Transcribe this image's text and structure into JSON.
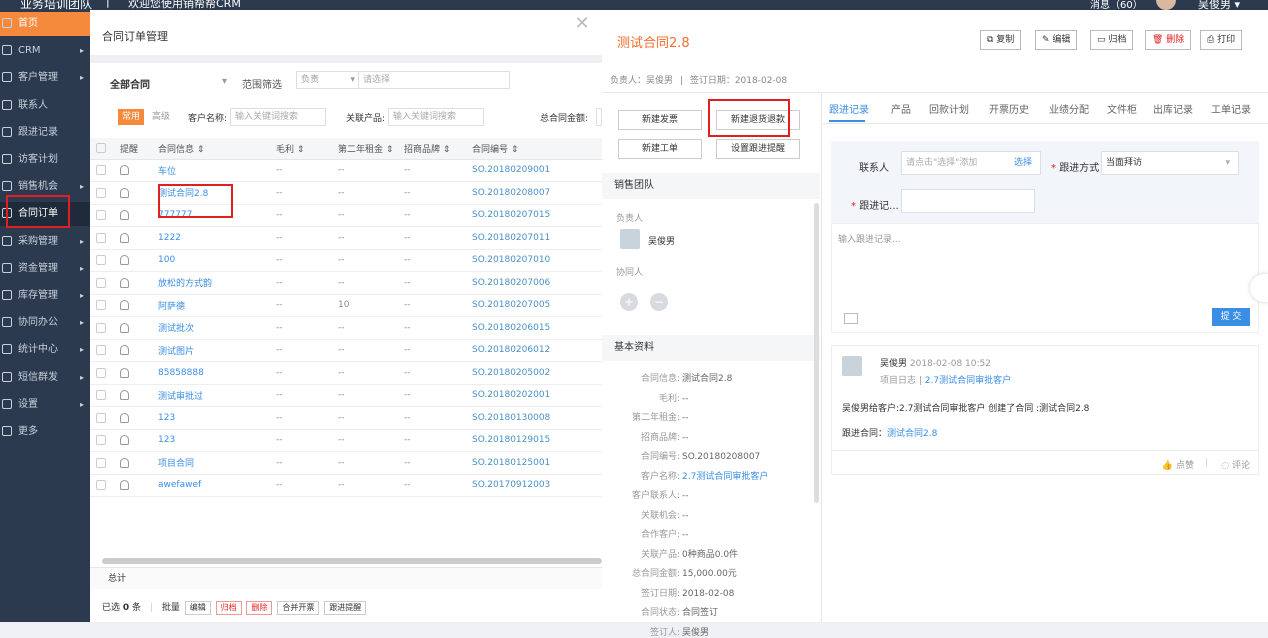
{
  "topbar": {
    "company": "业务培训团队",
    "separator": "|",
    "welcome": "欢迎您使用销帮帮CRM",
    "messages": "消息（60）",
    "user": "吴俊男 ▾"
  },
  "sidebar": {
    "items": [
      {
        "label": "首页",
        "arrow": ""
      },
      {
        "label": "CRM",
        "arrow": "▸"
      },
      {
        "label": "客户管理",
        "arrow": "▸"
      },
      {
        "label": "联系人",
        "arrow": ""
      },
      {
        "label": "跟进记录",
        "arrow": ""
      },
      {
        "label": "访客计划",
        "arrow": ""
      },
      {
        "label": "销售机会",
        "arrow": "▸"
      },
      {
        "label": "合同订单",
        "arrow": ""
      },
      {
        "label": "采购管理",
        "arrow": "▸"
      },
      {
        "label": "资金管理",
        "arrow": "▸"
      },
      {
        "label": "库存管理",
        "arrow": "▸"
      },
      {
        "label": "协同办公",
        "arrow": "▸"
      },
      {
        "label": "统计中心",
        "arrow": "▸"
      },
      {
        "label": "短信群发",
        "arrow": "▸"
      },
      {
        "label": "设置",
        "arrow": "▸"
      },
      {
        "label": "更多",
        "arrow": ""
      }
    ]
  },
  "list": {
    "page_title": "合同订单管理",
    "all_label": "全部合同",
    "range_label": "范围筛选",
    "range_value": "负责",
    "range_placeholder": "请选择",
    "tab_common": "常用",
    "tab_advanced": "高级",
    "customer_label": "客户名称:",
    "customer_placeholder": "输入关键词搜索",
    "product_label": "关联产品:",
    "product_placeholder": "输入关键词搜索",
    "amount_label": "总合同金额:",
    "columns": [
      "提醒",
      "合同信息 ⇕",
      "毛利 ⇕",
      "第二年租金 ⇕",
      "招商品牌 ⇕",
      "合同编号 ⇕"
    ],
    "rows": [
      {
        "name": "车位",
        "margin": "--",
        "rent": "--",
        "brand": "--",
        "code": "SO.20180209001"
      },
      {
        "name": "测试合同2.8",
        "margin": "--",
        "rent": "--",
        "brand": "--",
        "code": "SO.20180208007"
      },
      {
        "name": "777777",
        "margin": "--",
        "rent": "--",
        "brand": "--",
        "code": "SO.20180207015"
      },
      {
        "name": "1222",
        "margin": "--",
        "rent": "--",
        "brand": "--",
        "code": "SO.20180207011"
      },
      {
        "name": "100",
        "margin": "--",
        "rent": "--",
        "brand": "--",
        "code": "SO.20180207010"
      },
      {
        "name": "放松的方式韵",
        "margin": "--",
        "rent": "--",
        "brand": "--",
        "code": "SO.20180207006"
      },
      {
        "name": "阿萨德",
        "margin": "--",
        "rent": "10",
        "brand": "--",
        "code": "SO.20180207005"
      },
      {
        "name": "测试批次",
        "margin": "--",
        "rent": "--",
        "brand": "--",
        "code": "SO.20180206015"
      },
      {
        "name": "测试图片",
        "margin": "--",
        "rent": "--",
        "brand": "--",
        "code": "SO.20180206012"
      },
      {
        "name": "85858888",
        "margin": "--",
        "rent": "--",
        "brand": "--",
        "code": "SO.20180205002"
      },
      {
        "name": "测试审批过",
        "margin": "--",
        "rent": "--",
        "brand": "--",
        "code": "SO.20180202001"
      },
      {
        "name": "123",
        "margin": "--",
        "rent": "--",
        "brand": "--",
        "code": "SO.20180130008"
      },
      {
        "name": "123",
        "margin": "--",
        "rent": "--",
        "brand": "--",
        "code": "SO.20180129015"
      },
      {
        "name": "项目合同",
        "margin": "--",
        "rent": "--",
        "brand": "--",
        "code": "SO.20180125001"
      },
      {
        "name": "awefawef",
        "margin": "--",
        "rent": "--",
        "brand": "--",
        "code": "SO.20170912003"
      }
    ],
    "total_label": "总计",
    "selected_prefix": "已选",
    "selected_count": "0",
    "selected_suffix": "条",
    "batch_label": "批量",
    "bottom_buttons": [
      "编辑",
      "归档",
      "删除",
      "合并开票",
      "跟进提醒"
    ]
  },
  "close_label": "✕",
  "detail": {
    "title": "测试合同2.8",
    "buttons": [
      "复制",
      "编辑",
      "归档",
      "删除",
      "打印"
    ],
    "owner_meta": "负责人：吴俊男",
    "meta_sep": "|",
    "sign_meta": "签订日期：2018-02-08",
    "actions": [
      "新建发票",
      "新建退货退款",
      "新建工单",
      "设置跟进提醒"
    ],
    "sales_team": "销售团队",
    "owner_label": "负责人",
    "owner_name": "吴俊男",
    "collab_label": "协同人",
    "basic_info": "基本资料",
    "fields": [
      {
        "k": "合同信息:",
        "v": "测试合同2.8",
        "link": false
      },
      {
        "k": "毛利:",
        "v": "--",
        "link": false
      },
      {
        "k": "第二年租金:",
        "v": "--",
        "link": false
      },
      {
        "k": "招商品牌:",
        "v": "--",
        "link": false
      },
      {
        "k": "合同编号:",
        "v": "SO.20180208007",
        "link": false
      },
      {
        "k": "客户名称:",
        "v": "2.7测试合同审批客户",
        "link": true
      },
      {
        "k": "客户联系人:",
        "v": "--",
        "link": false
      },
      {
        "k": "关联机会:",
        "v": "--",
        "link": false
      },
      {
        "k": "合作客户:",
        "v": "--",
        "link": false
      },
      {
        "k": "关联产品:",
        "v": "0种商品0.0件",
        "link": false
      },
      {
        "k": "总合同金额:",
        "v": "15,000.00元",
        "link": false
      },
      {
        "k": "签订日期:",
        "v": "2018-02-08",
        "link": false
      },
      {
        "k": "合同状态:",
        "v": "合同签订",
        "link": false
      },
      {
        "k": "签订人:",
        "v": "吴俊男",
        "link": false
      }
    ],
    "tabs": [
      "跟进记录",
      "产品",
      "回款计划",
      "开票历史",
      "业绩分配",
      "文件柜",
      "出库记录",
      "工单记录"
    ],
    "form": {
      "contact_label": "联系人",
      "contact_placeholder": "请点击\"选择\"添加",
      "choose": "选择",
      "method_label": "跟进方式",
      "method_value": "当面拜访",
      "next_label": "跟进记...",
      "note_placeholder": "输入跟进记录...",
      "submit": "提 交"
    },
    "log": {
      "author": "吴俊男",
      "time": "2018-02-08 10:52",
      "project_label": "项目日志",
      "project_link": "2.7测试合同审批客户",
      "content": "吴俊男给客户:2.7测试合同审批客户 创建了合同 :测试合同2.8",
      "follow_label": "跟进合同：",
      "follow_link": "测试合同2.8",
      "like": "点赞",
      "comment": "评论"
    }
  }
}
